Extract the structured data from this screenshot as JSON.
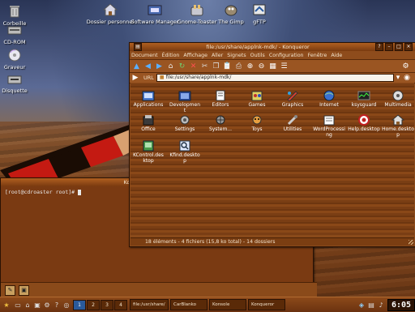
{
  "desktop": {
    "icons": [
      {
        "label": "Corbeille",
        "icon": "trash-icon"
      },
      {
        "label": "CD-ROM",
        "icon": "cdrom-icon"
      },
      {
        "label": "Graveur",
        "icon": "burner-icon"
      },
      {
        "label": "Disquette",
        "icon": "floppy-icon"
      },
      {
        "label": "Dossier personnel",
        "icon": "home-folder-icon"
      },
      {
        "label": "Software Manager",
        "icon": "software-manager-icon"
      },
      {
        "label": "Gnome-Toaster",
        "icon": "gnome-toaster-icon"
      },
      {
        "label": "The Gimp",
        "icon": "gimp-icon"
      },
      {
        "label": "gFTP",
        "icon": "gftp-icon"
      }
    ]
  },
  "konqueror": {
    "title": "file:/usr/share/applnk-mdk/ - Konqueror",
    "menu": [
      "Document",
      "Édition",
      "Affichage",
      "Aller",
      "Signets",
      "Outils",
      "Configuration",
      "Fenêtre",
      "Aide"
    ],
    "url_label": "URL",
    "url": "file:/usr/share/applnk-mdk/",
    "items": [
      {
        "name": "Applications",
        "icon": "applications-icon"
      },
      {
        "name": "Development",
        "icon": "development-icon"
      },
      {
        "name": "Editors",
        "icon": "editors-icon"
      },
      {
        "name": "Games",
        "icon": "games-icon"
      },
      {
        "name": "Graphics",
        "icon": "graphics-icon"
      },
      {
        "name": "Internet",
        "icon": "internet-icon"
      },
      {
        "name": "ksysguard",
        "icon": "ksysguard-icon"
      },
      {
        "name": "Multimedia",
        "icon": "multimedia-icon"
      },
      {
        "name": "Office",
        "icon": "office-icon"
      },
      {
        "name": "Settings",
        "icon": "settings-icon"
      },
      {
        "name": "System...",
        "icon": "system-icon"
      },
      {
        "name": "Toys",
        "icon": "toys-icon"
      },
      {
        "name": "Utilities",
        "icon": "utilities-icon"
      },
      {
        "name": "WordProcessing",
        "icon": "wordprocessing-icon"
      },
      {
        "name": "Help.desktop",
        "icon": "help-icon"
      },
      {
        "name": "Home.desktop",
        "icon": "home-icon"
      },
      {
        "name": "KControl.desktop",
        "icon": "kcontrol-icon"
      },
      {
        "name": "Kfind.desktop",
        "icon": "kfind-icon"
      }
    ],
    "status": "18 éléments - 4 fichiers (15,8 ko total) - 14 dossiers"
  },
  "konsole": {
    "title": "Konsole - root@cdroaster",
    "prompt": "[root@cdroaster root]# "
  },
  "taskbar": {
    "pager": [
      "1",
      "2",
      "3",
      "4"
    ],
    "current_desktop": "1",
    "tasks": [
      "file:/usr/share/",
      "CarBlanko",
      "Konsole",
      "Konqueror"
    ],
    "clock": "6:05"
  },
  "colors": {
    "wood_dark": "#6e3610",
    "wood_light": "#9a5522",
    "title_gradient_top": "#b06020",
    "clock_bg": "#2a1204"
  }
}
